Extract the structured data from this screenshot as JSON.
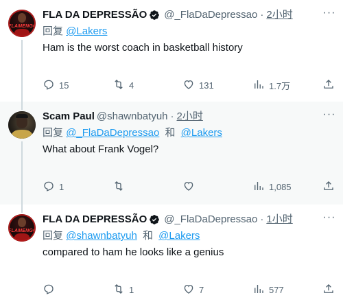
{
  "tweets": [
    {
      "name": "FLA DA DEPRESSÃO",
      "handle": "@_FlaDaDepressao",
      "time": "2小时",
      "reply_label": "回复",
      "reply_to": [
        "@Lakers"
      ],
      "text": "Ham is the worst coach in basketball history",
      "stats": {
        "replies": "15",
        "retweets": "4",
        "likes": "131",
        "views": "1.7万"
      }
    },
    {
      "name": "Scam Paul",
      "handle": "@shawnbatyuh",
      "time": "2小时",
      "reply_label": "回复",
      "reply_to": [
        "@_FlaDaDepressao",
        "@Lakers"
      ],
      "and_label": "和",
      "text": "What about Frank Vogel?",
      "stats": {
        "replies": "1",
        "retweets": "",
        "likes": "",
        "views": "1,085"
      }
    },
    {
      "name": "FLA DA DEPRESSÃO",
      "handle": "@_FlaDaDepressao",
      "time": "1小时",
      "reply_label": "回复",
      "reply_to": [
        "@shawnbatyuh",
        "@Lakers"
      ],
      "and_label": "和",
      "text": "compared to ham he looks like a genius",
      "stats": {
        "replies": "",
        "retweets": "1",
        "likes": "7",
        "views": "577"
      }
    }
  ],
  "avatar_text": "FLAMENGO",
  "colors": {
    "accent": "#1d9bf0",
    "muted": "#536471",
    "text": "#0f1419",
    "line": "#cfd9de"
  },
  "icons": [
    "reply-icon",
    "retweet-icon",
    "like-icon",
    "views-icon",
    "share-icon",
    "verified-badge-icon",
    "more-icon"
  ]
}
